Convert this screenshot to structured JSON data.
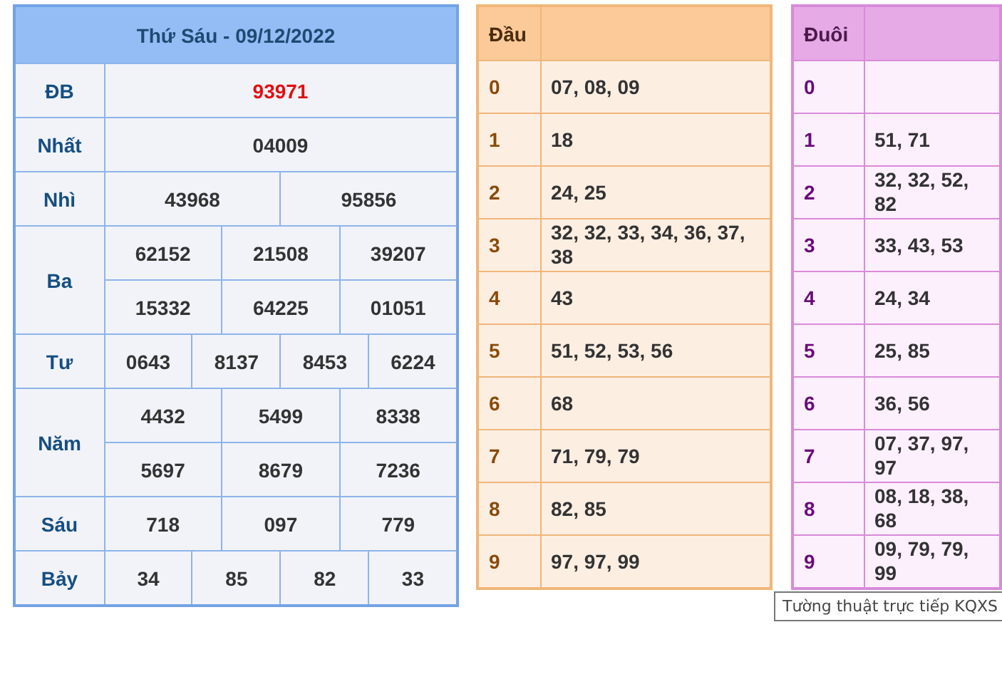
{
  "results": {
    "title": "Thứ Sáu - 09/12/2022",
    "prizes": [
      {
        "label": "ĐB",
        "kind": "special",
        "rows": [
          [
            "93971"
          ]
        ]
      },
      {
        "label": "Nhất",
        "kind": "normal",
        "rows": [
          [
            "04009"
          ]
        ]
      },
      {
        "label": "Nhì",
        "kind": "normal",
        "rows": [
          [
            "43968",
            "95856"
          ]
        ]
      },
      {
        "label": "Ba",
        "kind": "normal",
        "rows": [
          [
            "62152",
            "21508",
            "39207"
          ],
          [
            "15332",
            "64225",
            "01051"
          ]
        ]
      },
      {
        "label": "Tư",
        "kind": "normal",
        "rows": [
          [
            "0643",
            "8137",
            "8453",
            "6224"
          ]
        ]
      },
      {
        "label": "Năm",
        "kind": "normal",
        "rows": [
          [
            "4432",
            "5499",
            "8338"
          ],
          [
            "5697",
            "8679",
            "7236"
          ]
        ]
      },
      {
        "label": "Sáu",
        "kind": "normal",
        "rows": [
          [
            "718",
            "097",
            "779"
          ]
        ]
      },
      {
        "label": "Bảy",
        "kind": "normal",
        "rows": [
          [
            "34",
            "85",
            "82",
            "33"
          ]
        ]
      }
    ]
  },
  "head_table": {
    "heading": "Đầu",
    "rows": [
      {
        "digit": "0",
        "numbers": "07, 08, 09"
      },
      {
        "digit": "1",
        "numbers": "18"
      },
      {
        "digit": "2",
        "numbers": "24, 25"
      },
      {
        "digit": "3",
        "numbers": "32, 32, 33, 34, 36, 37, 38"
      },
      {
        "digit": "4",
        "numbers": "43"
      },
      {
        "digit": "5",
        "numbers": "51, 52, 53, 56"
      },
      {
        "digit": "6",
        "numbers": "68"
      },
      {
        "digit": "7",
        "numbers": "71, 79, 79"
      },
      {
        "digit": "8",
        "numbers": "82, 85"
      },
      {
        "digit": "9",
        "numbers": "97, 97, 99"
      }
    ]
  },
  "tail_table": {
    "heading": "Đuôi",
    "rows": [
      {
        "digit": "0"
      },
      {
        "digit": "1",
        "numbers": "51, 71"
      },
      {
        "digit": "2",
        "numbers": "32, 32, 52, 82"
      },
      {
        "digit": "3",
        "numbers": "33, 43, 53"
      },
      {
        "digit": "4",
        "numbers": "24, 34"
      },
      {
        "digit": "5",
        "numbers": "25, 85"
      },
      {
        "digit": "6",
        "numbers": "36, 56"
      },
      {
        "digit": "7",
        "numbers": "07, 37, 97, 97"
      },
      {
        "digit": "8",
        "numbers": "08, 18, 38, 68"
      },
      {
        "digit": "9",
        "numbers": "09, 79, 79, 99"
      }
    ]
  },
  "tooltip": "Tường thuật trực tiếp KQXS"
}
